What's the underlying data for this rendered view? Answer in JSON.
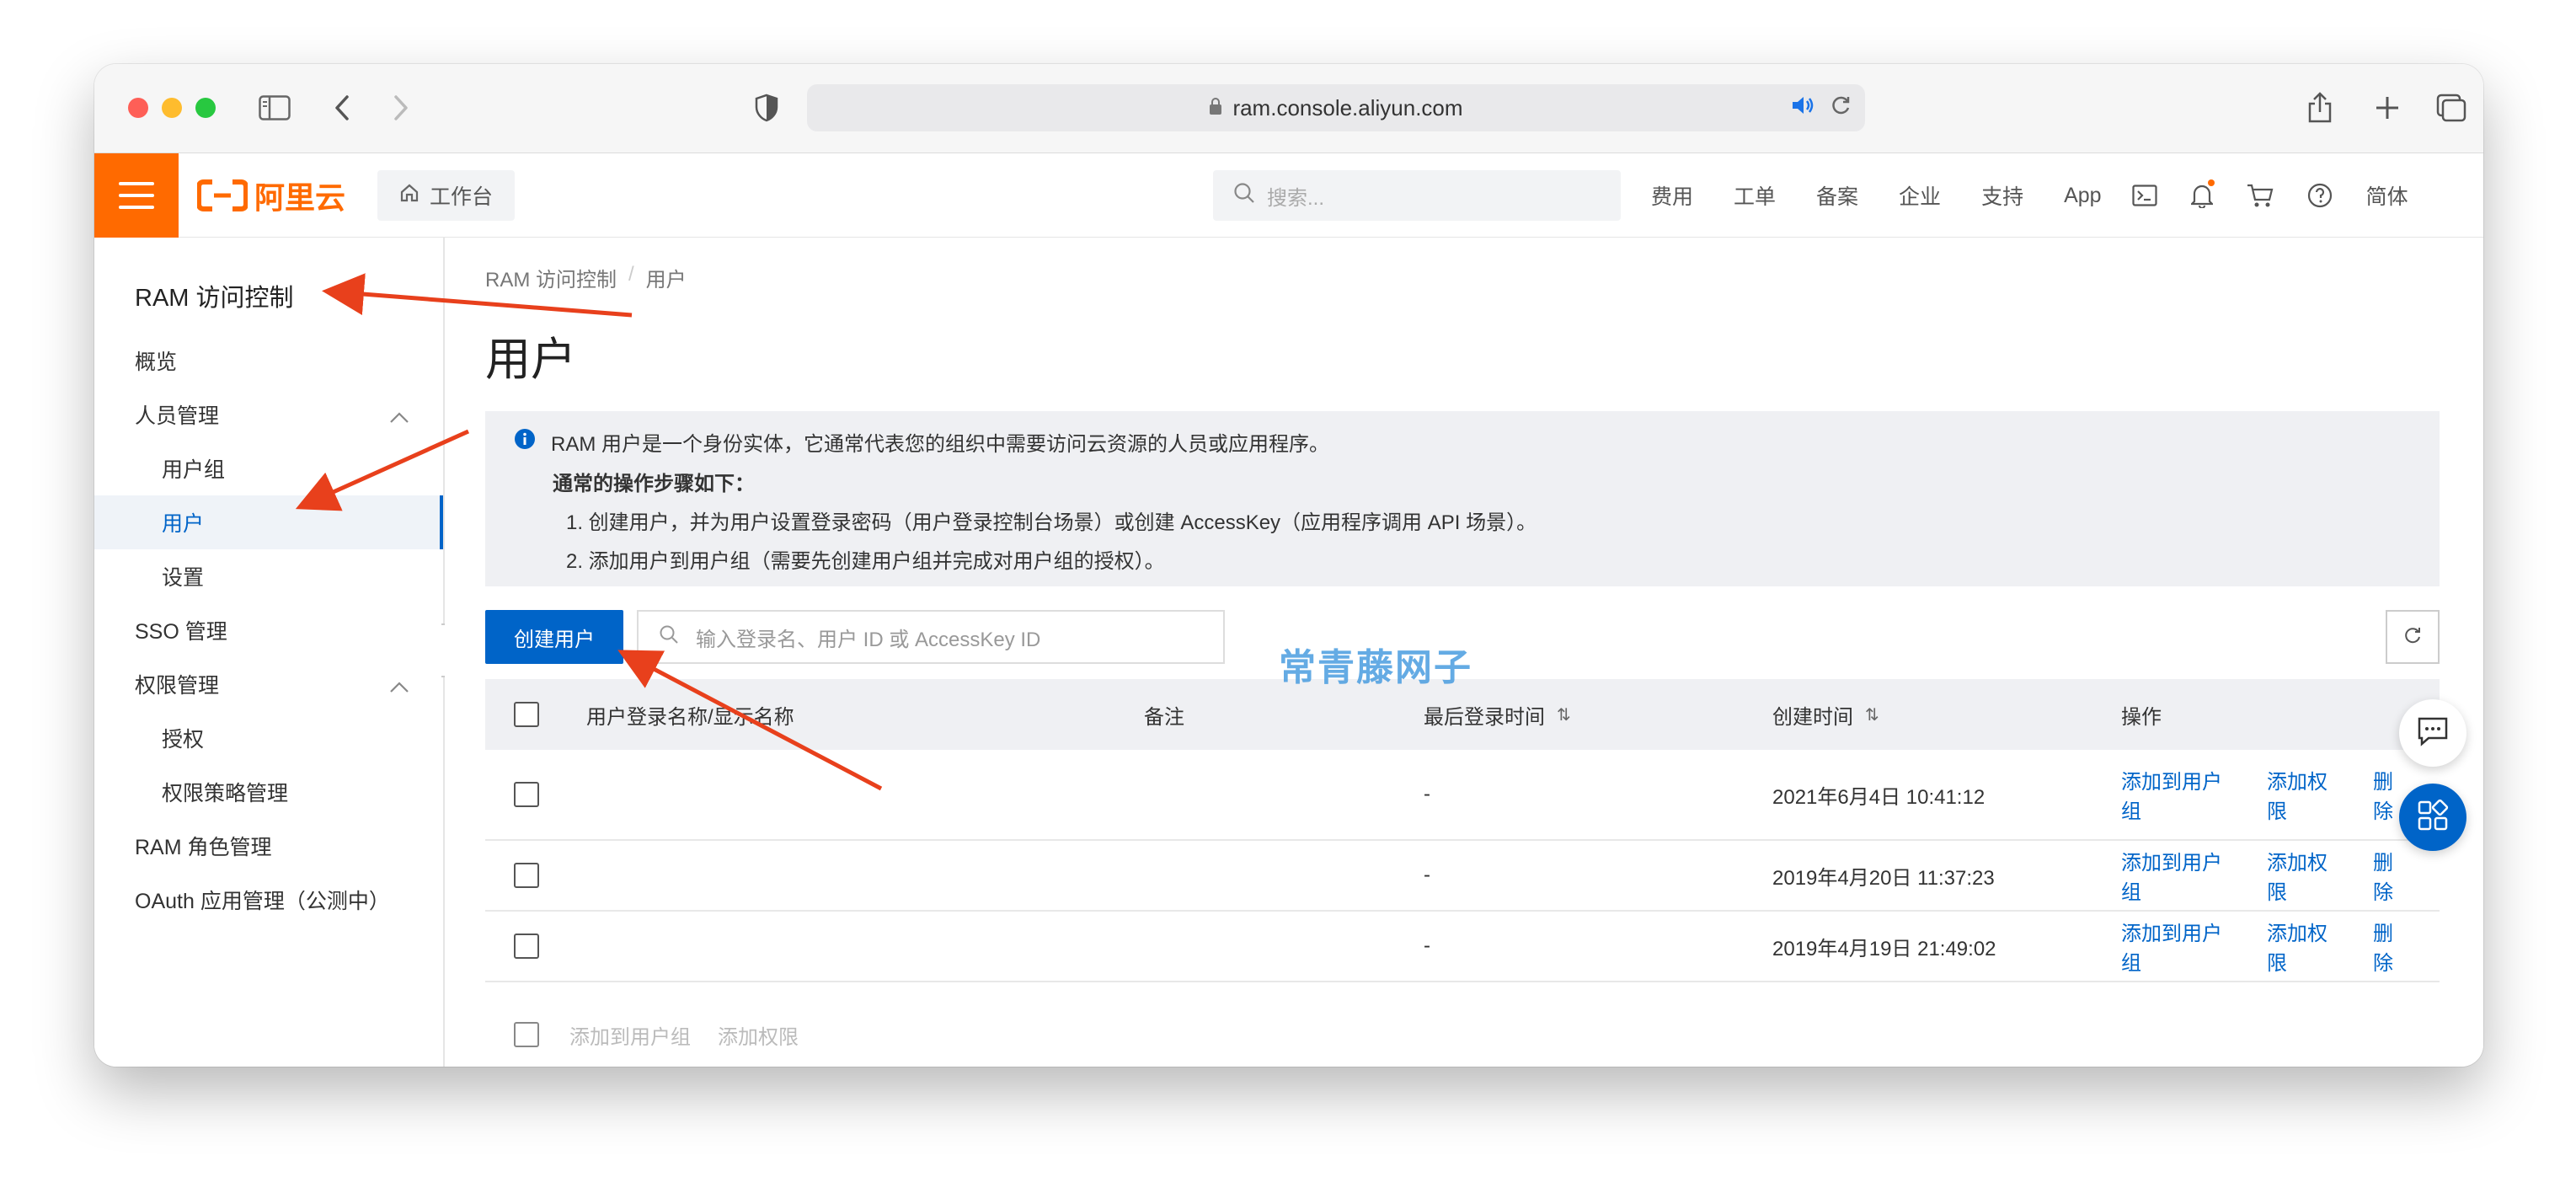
{
  "browser": {
    "url": "ram.console.aliyun.com"
  },
  "topnav": {
    "logo_text": "阿里云",
    "workbench_label": "工作台",
    "search_placeholder": "搜索...",
    "links": [
      "费用",
      "工单",
      "备案",
      "企业",
      "支持",
      "App"
    ],
    "lang_label": "简体",
    "brand_color": "#ff6a00"
  },
  "sidebar": {
    "title": "RAM 访问控制",
    "items": [
      {
        "label": "概览"
      },
      {
        "label": "人员管理"
      },
      {
        "label": "用户组"
      },
      {
        "label": "用户"
      },
      {
        "label": "设置"
      },
      {
        "label": "SSO 管理"
      },
      {
        "label": "权限管理"
      },
      {
        "label": "授权"
      },
      {
        "label": "权限策略管理"
      },
      {
        "label": "RAM 角色管理"
      },
      {
        "label": "OAuth 应用管理（公测中）"
      }
    ]
  },
  "main": {
    "breadcrumb": [
      "RAM 访问控制",
      "用户"
    ],
    "title": "用户",
    "info": {
      "line1": "RAM 用户是一个身份实体，它通常代表您的组织中需要访问云资源的人员或应用程序。",
      "line2": "通常的操作步骤如下：",
      "step1": "1.  创建用户，并为用户设置登录密码（用户登录控制台场景）或创建 AccessKey（应用程序调用 API 场景）。",
      "step2": "2.  添加用户到用户组（需要先创建用户组并完成对用户组的授权）。"
    },
    "create_button": "创建用户",
    "search_placeholder": "输入登录名、用户 ID 或 AccessKey ID",
    "table": {
      "headers": [
        "用户登录名称/显示名称",
        "备注",
        "最后登录时间",
        "创建时间",
        "操作"
      ],
      "rows": [
        {
          "name": "",
          "note": "",
          "last_login": "-",
          "created": "2021年6月4日 10:41:12"
        },
        {
          "name": "",
          "note": "",
          "last_login": "-",
          "created": "2019年4月20日 11:37:23"
        },
        {
          "name": "",
          "note": "",
          "last_login": "-",
          "created": "2019年4月19日 21:49:02"
        }
      ],
      "row_actions": [
        "添加到用户组",
        "添加权限",
        "删除"
      ],
      "bulk_actions": [
        "添加到用户组",
        "添加权限"
      ]
    },
    "accent_color": "#0064c8"
  },
  "watermark": "常青藤网子"
}
